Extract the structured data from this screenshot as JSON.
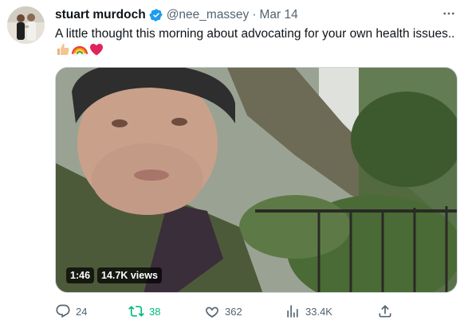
{
  "author": {
    "name": "stuart murdoch",
    "handle": "@nee_massey",
    "separator": "·",
    "date": "Mar 14",
    "verified": true
  },
  "tweet": {
    "text": "A little thought this morning about advocating for your own health issues..",
    "emojis": [
      "thumbs-up-icon",
      "rainbow-icon",
      "red-heart-icon"
    ]
  },
  "video": {
    "duration": "1:46",
    "views": "14.7K views"
  },
  "actions": {
    "replies": "24",
    "reposts": "38",
    "likes": "362",
    "views": "33.4K"
  },
  "colors": {
    "text": "#0f1419",
    "secondary": "#536471",
    "verified": "#1d9bf0",
    "repost_active": "#00ba7c"
  }
}
